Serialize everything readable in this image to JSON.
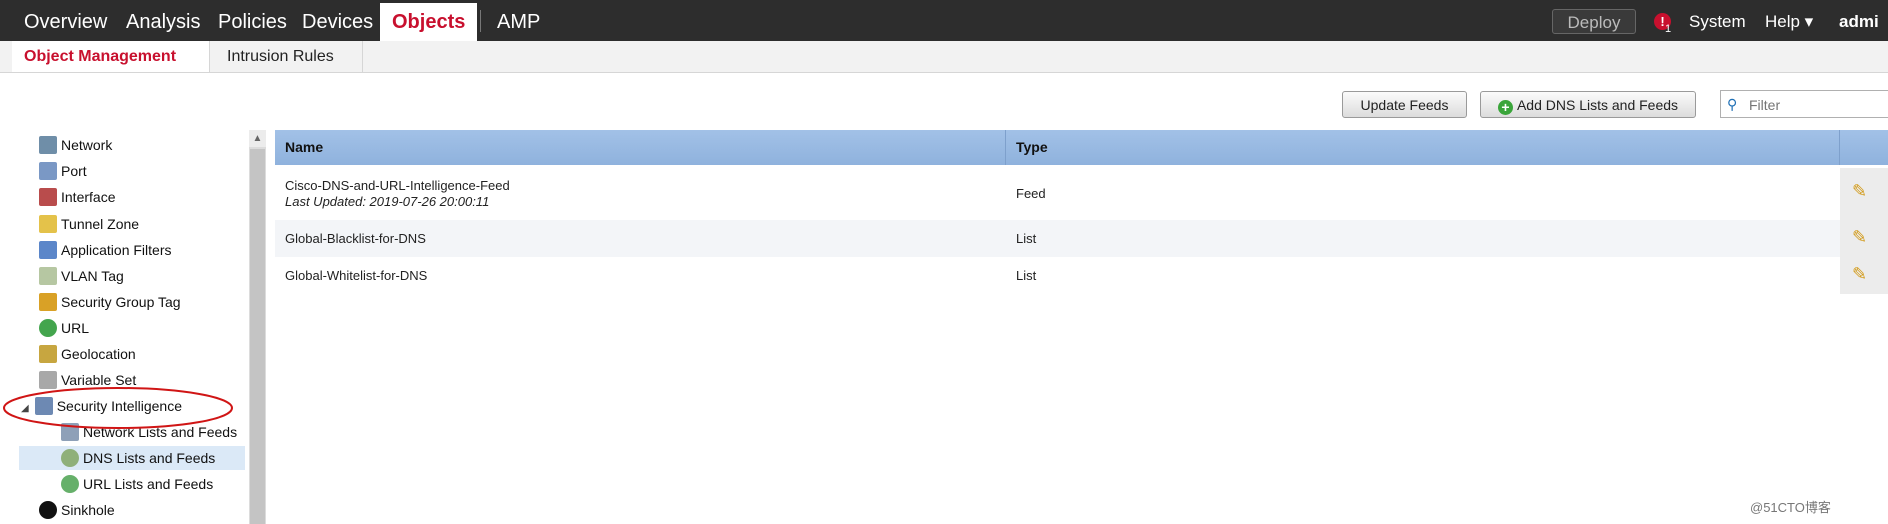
{
  "topnav": {
    "items": [
      "Overview",
      "Analysis",
      "Policies",
      "Devices",
      "Objects",
      "AMP"
    ],
    "deploy": "Deploy",
    "alert_count": "1",
    "system": "System",
    "help": "Help ▾",
    "user": "admi"
  },
  "subnav": {
    "tabs": [
      "Object Management",
      "Intrusion Rules"
    ]
  },
  "toolbar": {
    "update_feeds": "Update Feeds",
    "add_dns": "Add DNS Lists and Feeds",
    "filter_placeholder": "Filter"
  },
  "sidebar": {
    "items": [
      {
        "label": "Network",
        "icon": "network-icon",
        "color": "#6f8ea8"
      },
      {
        "label": "Port",
        "icon": "port-icon",
        "color": "#7a98c5"
      },
      {
        "label": "Interface",
        "icon": "interface-icon",
        "color": "#b94c4c"
      },
      {
        "label": "Tunnel Zone",
        "icon": "tunnel-zone-icon",
        "color": "#e4c24a"
      },
      {
        "label": "Application Filters",
        "icon": "application-filters-icon",
        "color": "#5b86c9"
      },
      {
        "label": "VLAN Tag",
        "icon": "vlan-tag-icon",
        "color": "#b6c7a2"
      },
      {
        "label": "Security Group Tag",
        "icon": "security-group-tag-icon",
        "color": "#d9a126"
      },
      {
        "label": "URL",
        "icon": "url-icon",
        "color": "#43a54d"
      },
      {
        "label": "Geolocation",
        "icon": "geolocation-icon",
        "color": "#c7a640"
      },
      {
        "label": "Variable Set",
        "icon": "variable-set-icon",
        "color": "#a8a8a8"
      },
      {
        "label": "Security Intelligence",
        "icon": "security-intelligence-icon",
        "color": "#6d89b3"
      },
      {
        "label": "Network Lists and Feeds",
        "icon": "network-lists-icon",
        "color": "#8ea0b8"
      },
      {
        "label": "DNS Lists and Feeds",
        "icon": "dns-lists-icon",
        "color": "#8fb07a"
      },
      {
        "label": "URL Lists and Feeds",
        "icon": "url-lists-icon",
        "color": "#66b06a"
      },
      {
        "label": "Sinkhole",
        "icon": "sinkhole-icon",
        "color": "#111111"
      }
    ]
  },
  "table": {
    "headers": [
      "Name",
      "Type"
    ],
    "rows": [
      {
        "name": "Cisco-DNS-and-URL-Intelligence-Feed",
        "sub": "Last Updated: 2019-07-26 20:00:11",
        "type": "Feed"
      },
      {
        "name": "Global-Blacklist-for-DNS",
        "type": "List"
      },
      {
        "name": "Global-Whitelist-for-DNS",
        "type": "List"
      }
    ]
  },
  "watermark": "@51CTO博客"
}
